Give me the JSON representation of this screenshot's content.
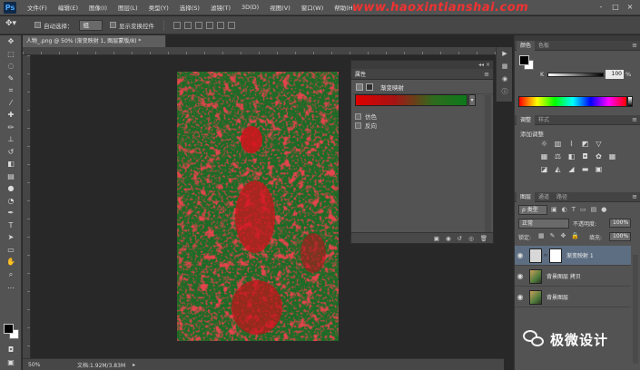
{
  "app": {
    "logo": "Ps"
  },
  "watermark": "www.haoxintianshai.com",
  "menu": [
    "文件(F)",
    "编辑(E)",
    "图像(I)",
    "图层(L)",
    "类型(Y)",
    "选择(S)",
    "滤镜(T)",
    "3D(D)",
    "视图(V)",
    "窗口(W)",
    "帮助(H)"
  ],
  "window_controls": [
    "-",
    "□",
    "×"
  ],
  "options_bar": {
    "auto_select_label": "自动选择：",
    "auto_select_value": "组",
    "show_transform_label": "显示变换控件"
  },
  "document": {
    "tab_title": "人物_.png @ 50% (渐变映射 1, 图层蒙版/8) *",
    "zoom": "50%",
    "doc_info": "文档:1.92M/3.83M"
  },
  "properties": {
    "tab_label": "属性",
    "header_label": "渐变映射",
    "dither_label": "仿色",
    "reverse_label": "反向",
    "colors": {
      "gradient_start": "#e00000",
      "gradient_end": "#0d7a1a"
    }
  },
  "color_panel": {
    "tabs": [
      "颜色",
      "色板"
    ],
    "channel": "K",
    "value": "100",
    "unit": "%"
  },
  "adjustments": {
    "tabs": [
      "调整",
      "样式"
    ],
    "title": "添加调整"
  },
  "layers_panel": {
    "tabs": [
      "图层",
      "通道",
      "路径"
    ],
    "filter_value": "ρ 类型",
    "blend_mode": "正常",
    "opacity_label": "不透明度:",
    "opacity_value": "100%",
    "lock_label": "锁定:",
    "fill_label": "填充:",
    "fill_value": "100%",
    "layers": [
      {
        "name": "渐变映射 1",
        "selected": true
      },
      {
        "name": "背景图层 拷贝",
        "selected": false
      },
      {
        "name": "背景图层",
        "selected": false
      }
    ]
  },
  "branding": {
    "text": "极微设计"
  }
}
